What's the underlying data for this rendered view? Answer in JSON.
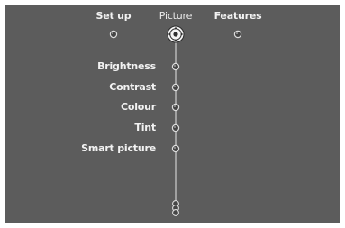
{
  "menu": {
    "tabs": [
      {
        "label": "Set up",
        "active": false
      },
      {
        "label": "Picture",
        "active": true
      },
      {
        "label": "Features",
        "active": false
      }
    ],
    "items": [
      {
        "label": "Brightness"
      },
      {
        "label": "Contrast"
      },
      {
        "label": "Colour"
      },
      {
        "label": "Tint"
      },
      {
        "label": "Smart picture"
      }
    ],
    "more_items_indicator": "scroll-down-indicator"
  },
  "colors": {
    "background": "#5c5c5c",
    "text": "#f2f2f2",
    "node_fill": "#4a4a4a",
    "node_stroke": "#d8d8d8",
    "selector": "#ffffff"
  },
  "icons": {
    "selected_tab": "four-way-navigation-icon",
    "inactive_tab": "circle-node-icon",
    "item": "circle-node-icon",
    "scroll": "stacked-nodes-icon"
  }
}
